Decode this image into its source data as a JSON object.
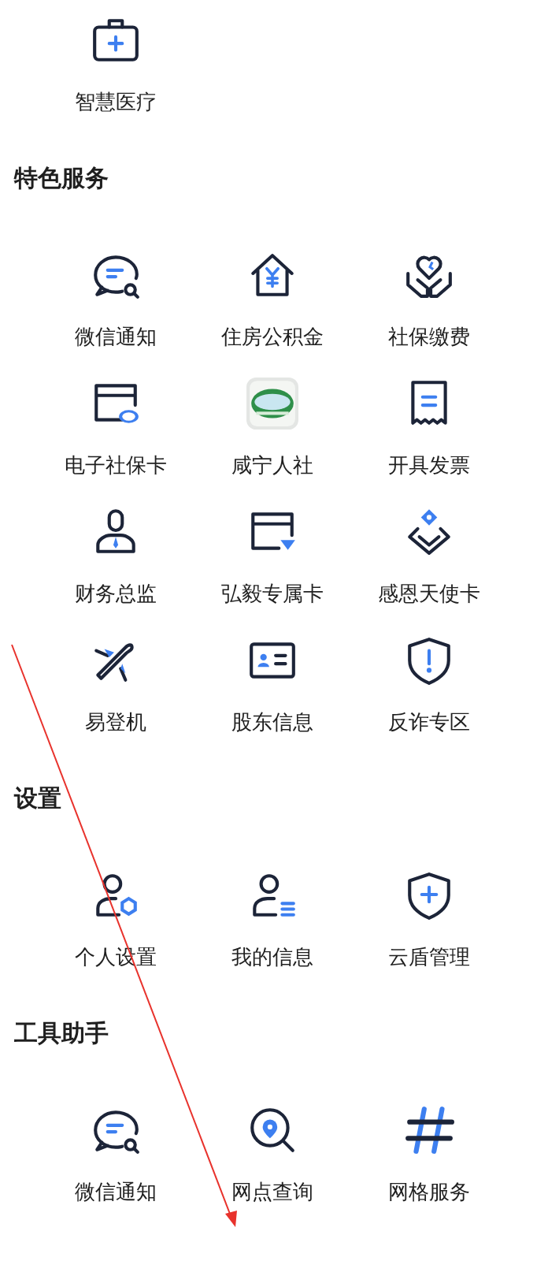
{
  "sections": [
    {
      "items": [
        {
          "label": "智慧医疗",
          "kind": "kit"
        }
      ]
    },
    {
      "title": "特色服务",
      "items": [
        {
          "label": "微信通知",
          "kind": "chat"
        },
        {
          "label": "住房公积金",
          "kind": "house"
        },
        {
          "label": "社保缴费",
          "kind": "heart"
        },
        {
          "label": "电子社保卡",
          "kind": "card"
        },
        {
          "label": "咸宁人社",
          "kind": "logo"
        },
        {
          "label": "开具发票",
          "kind": "receipt"
        },
        {
          "label": "财务总监",
          "kind": "person"
        },
        {
          "label": "弘毅专属卡",
          "kind": "diamondcard"
        },
        {
          "label": "感恩天使卡",
          "kind": "diamondpin"
        },
        {
          "label": "易登机",
          "kind": "plane"
        },
        {
          "label": "股东信息",
          "kind": "idcard"
        },
        {
          "label": "反诈专区",
          "kind": "shieldalert"
        }
      ]
    },
    {
      "title": "设置",
      "items": [
        {
          "label": "个人设置",
          "kind": "persongear"
        },
        {
          "label": "我的信息",
          "kind": "personlist"
        },
        {
          "label": "云盾管理",
          "kind": "shieldplus"
        }
      ]
    },
    {
      "title": "工具助手",
      "items": [
        {
          "label": "微信通知",
          "kind": "chat"
        },
        {
          "label": "网点查询",
          "kind": "pinsearch"
        },
        {
          "label": "网格服务",
          "kind": "hash"
        }
      ]
    }
  ],
  "annotation": {
    "kind": "arrow"
  }
}
